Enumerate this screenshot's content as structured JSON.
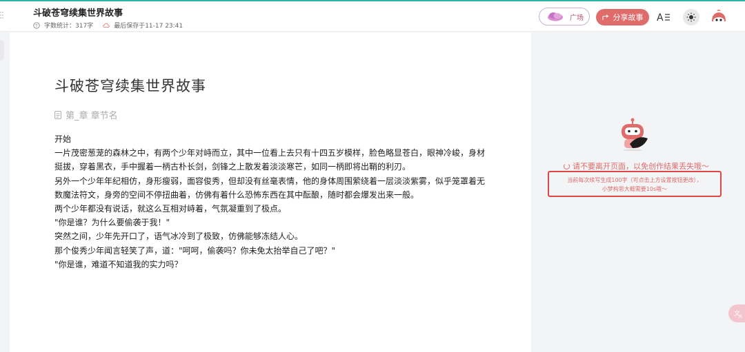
{
  "header": {
    "doc_title": "斗破苍穹续集世界故事",
    "word_count": "字数统计：317字",
    "last_saved": "最后保存于11-17 23:41",
    "plaza_label": "广场",
    "share_label": "分享故事"
  },
  "icons": {
    "grid": "grid-icon",
    "word_count": "text-count-icon",
    "saved": "cloud-save-icon",
    "plaza": "cloud-icon",
    "share": "share-icon",
    "font": "font-size-icon",
    "theme": "sun-icon",
    "avatar": "avatar-icon",
    "chapter": "document-icon",
    "translate": "translate-icon"
  },
  "editor": {
    "title": "斗破苍穹续集世界故事",
    "chapter_placeholder": "第_章 章节名",
    "paragraphs": [
      "开始",
      "一片茂密葱茏的森林之中，有两个少年对峙而立，其中一位看上去只有十四五岁模样，脸色略显苍白，眼神冷峻，身材挺拔，穿着黑衣，手中握着一柄古朴长剑，剑锋之上散发着淡淡寒芒，如同一柄即将出鞘的利刃。",
      "另外一个少年年纪相仿，身形瘦弱，面容俊秀，但却没有丝毫表情，他的身体周围萦绕着一层淡淡紫雾，似乎笼罩着无数魔法符文，身旁的空间不停扭曲着，仿佛有着什么恐怖东西在其中酝酿，随时都会爆发出来一般。",
      "两个少年都没有说话，就这么互相对峙着，气氛凝重到了极点。",
      "\"你是谁？为什么要偷袭于我！\"",
      "突然之间，少年先开口了，语气冰冷到了极致，仿佛能够冻结人心。",
      "那个俊秀少年闻言轻笑了声，道：\"呵呵，偷袭吗？你未免太抬举自己了吧？\"",
      "\"你是谁，难道不知道我的实力吗？"
    ]
  },
  "panel": {
    "waiting": "请不要离开页面，以免创作结果丢失哦～",
    "notice_line1": "当前每次续写生成100字（可点击上方设置按钮更改），",
    "notice_line2": "小梦构思大概需要10s哦～"
  },
  "colors": {
    "accent": "#e06b6b",
    "top_line": "#2fb3a7",
    "notice_border": "#e04545"
  }
}
